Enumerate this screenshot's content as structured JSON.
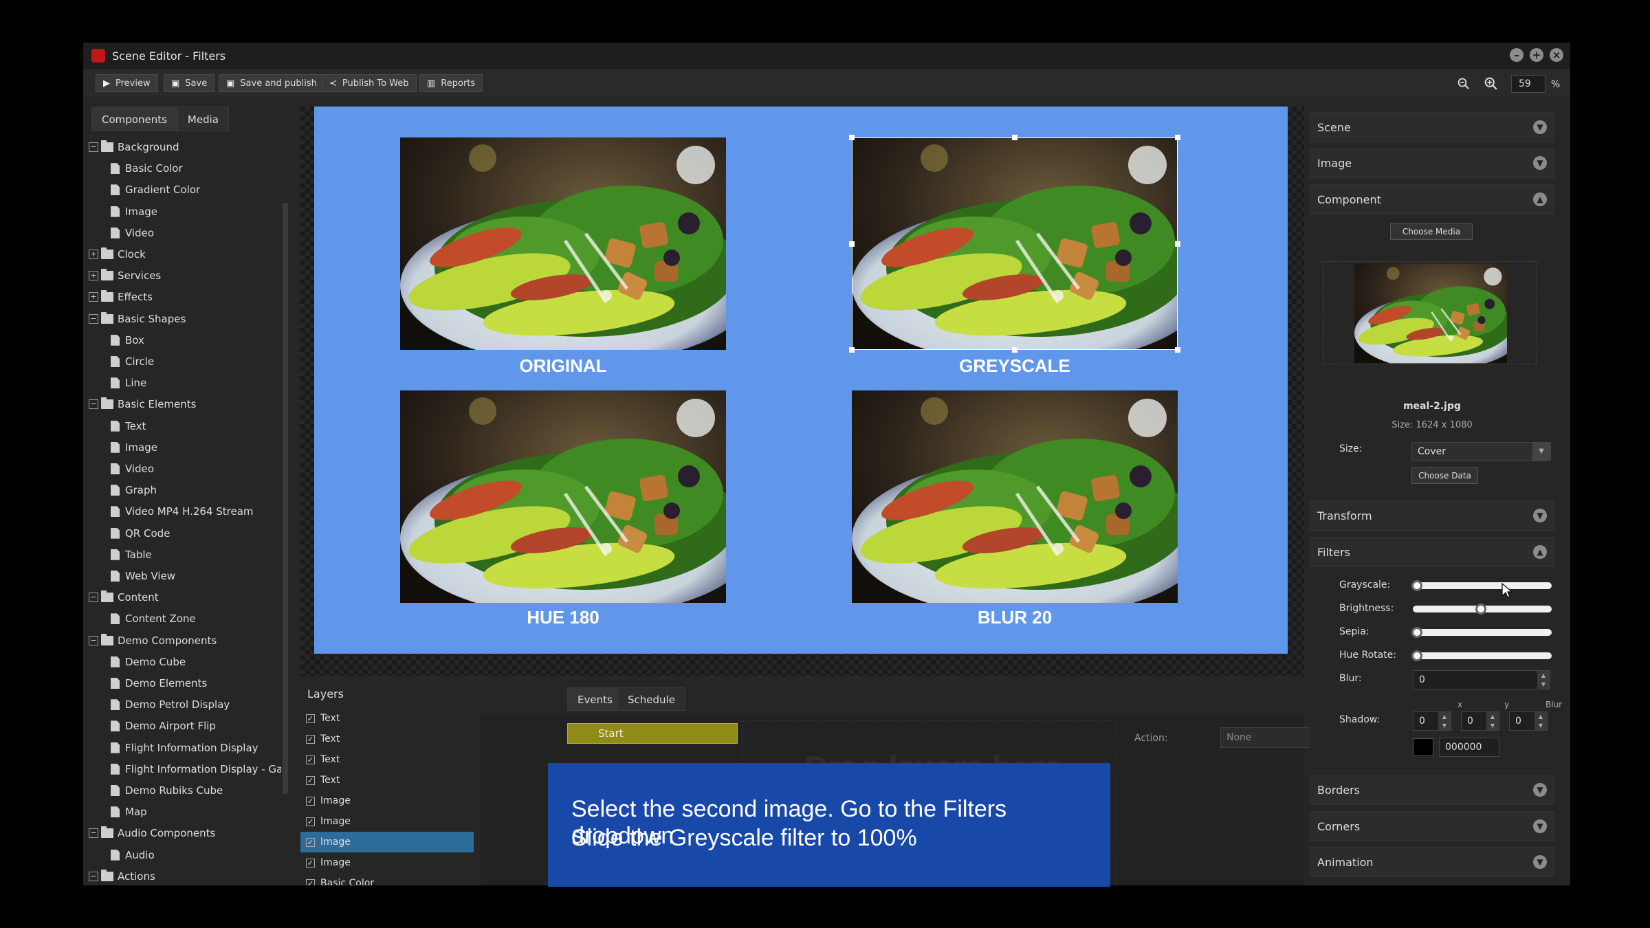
{
  "window": {
    "title": "Scene Editor - Filters"
  },
  "toolbar": {
    "preview": "Preview",
    "save": "Save",
    "save_publish": "Save and publish",
    "publish_web": "Publish To Web",
    "reports": "Reports",
    "zoom_value": "59",
    "zoom_unit": "%"
  },
  "left": {
    "tabs": [
      "Components",
      "Media"
    ],
    "tree": [
      {
        "label": "Background",
        "type": "folder",
        "expanded": true
      },
      {
        "label": "Basic Color",
        "type": "leaf"
      },
      {
        "label": "Gradient Color",
        "type": "leaf"
      },
      {
        "label": "Image",
        "type": "leaf"
      },
      {
        "label": "Video",
        "type": "leaf"
      },
      {
        "label": "Clock",
        "type": "folder",
        "expanded": false
      },
      {
        "label": "Services",
        "type": "folder",
        "expanded": false
      },
      {
        "label": "Effects",
        "type": "folder",
        "expanded": false
      },
      {
        "label": "Basic Shapes",
        "type": "folder",
        "expanded": true
      },
      {
        "label": "Box",
        "type": "leaf"
      },
      {
        "label": "Circle",
        "type": "leaf"
      },
      {
        "label": "Line",
        "type": "leaf"
      },
      {
        "label": "Basic Elements",
        "type": "folder",
        "expanded": true
      },
      {
        "label": "Text",
        "type": "leaf"
      },
      {
        "label": "Image",
        "type": "leaf"
      },
      {
        "label": "Video",
        "type": "leaf"
      },
      {
        "label": "Graph",
        "type": "leaf"
      },
      {
        "label": "Video MP4 H.264 Stream",
        "type": "leaf"
      },
      {
        "label": "QR Code",
        "type": "leaf"
      },
      {
        "label": "Table",
        "type": "leaf"
      },
      {
        "label": "Web View",
        "type": "leaf"
      },
      {
        "label": "Content",
        "type": "folder",
        "expanded": true
      },
      {
        "label": "Content Zone",
        "type": "leaf"
      },
      {
        "label": "Demo Components",
        "type": "folder",
        "expanded": true
      },
      {
        "label": "Demo Cube",
        "type": "leaf"
      },
      {
        "label": "Demo Elements",
        "type": "leaf"
      },
      {
        "label": "Demo Petrol Display",
        "type": "leaf"
      },
      {
        "label": "Demo Airport Flip",
        "type": "leaf"
      },
      {
        "label": "Flight Information Display",
        "type": "leaf"
      },
      {
        "label": "Flight Information Display - Gate",
        "type": "leaf"
      },
      {
        "label": "Demo Rubiks Cube",
        "type": "leaf"
      },
      {
        "label": "Map",
        "type": "leaf"
      },
      {
        "label": "Audio Components",
        "type": "folder",
        "expanded": true
      },
      {
        "label": "Audio",
        "type": "leaf"
      },
      {
        "label": "Actions",
        "type": "folder",
        "expanded": true
      }
    ]
  },
  "canvas": {
    "labels": [
      "ORIGINAL",
      "GREYSCALE",
      "HUE 180",
      "BLUR 20"
    ]
  },
  "layers": {
    "title": "Layers",
    "items": [
      "Text",
      "Text",
      "Text",
      "Text",
      "Image",
      "Image",
      "Image",
      "Image",
      "Basic Color"
    ],
    "selected_index": 6
  },
  "events": {
    "tabs": [
      "Events",
      "Schedule"
    ],
    "start": "Start",
    "drop_hint": "Drag layers here",
    "action_label": "Action:",
    "action_value": "None"
  },
  "right": {
    "sections": {
      "scene": "Scene",
      "image": "Image",
      "component": "Component",
      "transform": "Transform",
      "filters": "Filters",
      "borders": "Borders",
      "corners": "Corners",
      "animation": "Animation"
    },
    "component": {
      "choose_media": "Choose Media",
      "file_name": "meal-2.jpg",
      "file_size": "Size: 1624 x 1080",
      "size_label": "Size:",
      "size_value": "Cover",
      "choose_data": "Choose Data"
    },
    "filters": {
      "grayscale_label": "Grayscale:",
      "grayscale_value": 0,
      "brightness_label": "Brightness:",
      "brightness_value": 0.5,
      "sepia_label": "Sepia:",
      "sepia_value": 0,
      "hue_label": "Hue Rotate:",
      "hue_value": 0,
      "blur_label": "Blur:",
      "blur_value": "0",
      "shadow_label": "Shadow:",
      "shadow_x_label": "x",
      "shadow_y_label": "y",
      "shadow_blur_label": "Blur",
      "shadow_x": "0",
      "shadow_y": "0",
      "shadow_blur": "0",
      "shadow_color": "000000"
    }
  },
  "overlay": {
    "line1": "Select the second image. Go to the Filters dropdown",
    "line2": "Slide the Greyscale filter to 100%"
  },
  "colors": {
    "canvas_bg": "#6197ea",
    "selected_layer": "#2d6b9b",
    "start_bar": "#8f8b14",
    "overlay_bg": "#1848a8"
  }
}
